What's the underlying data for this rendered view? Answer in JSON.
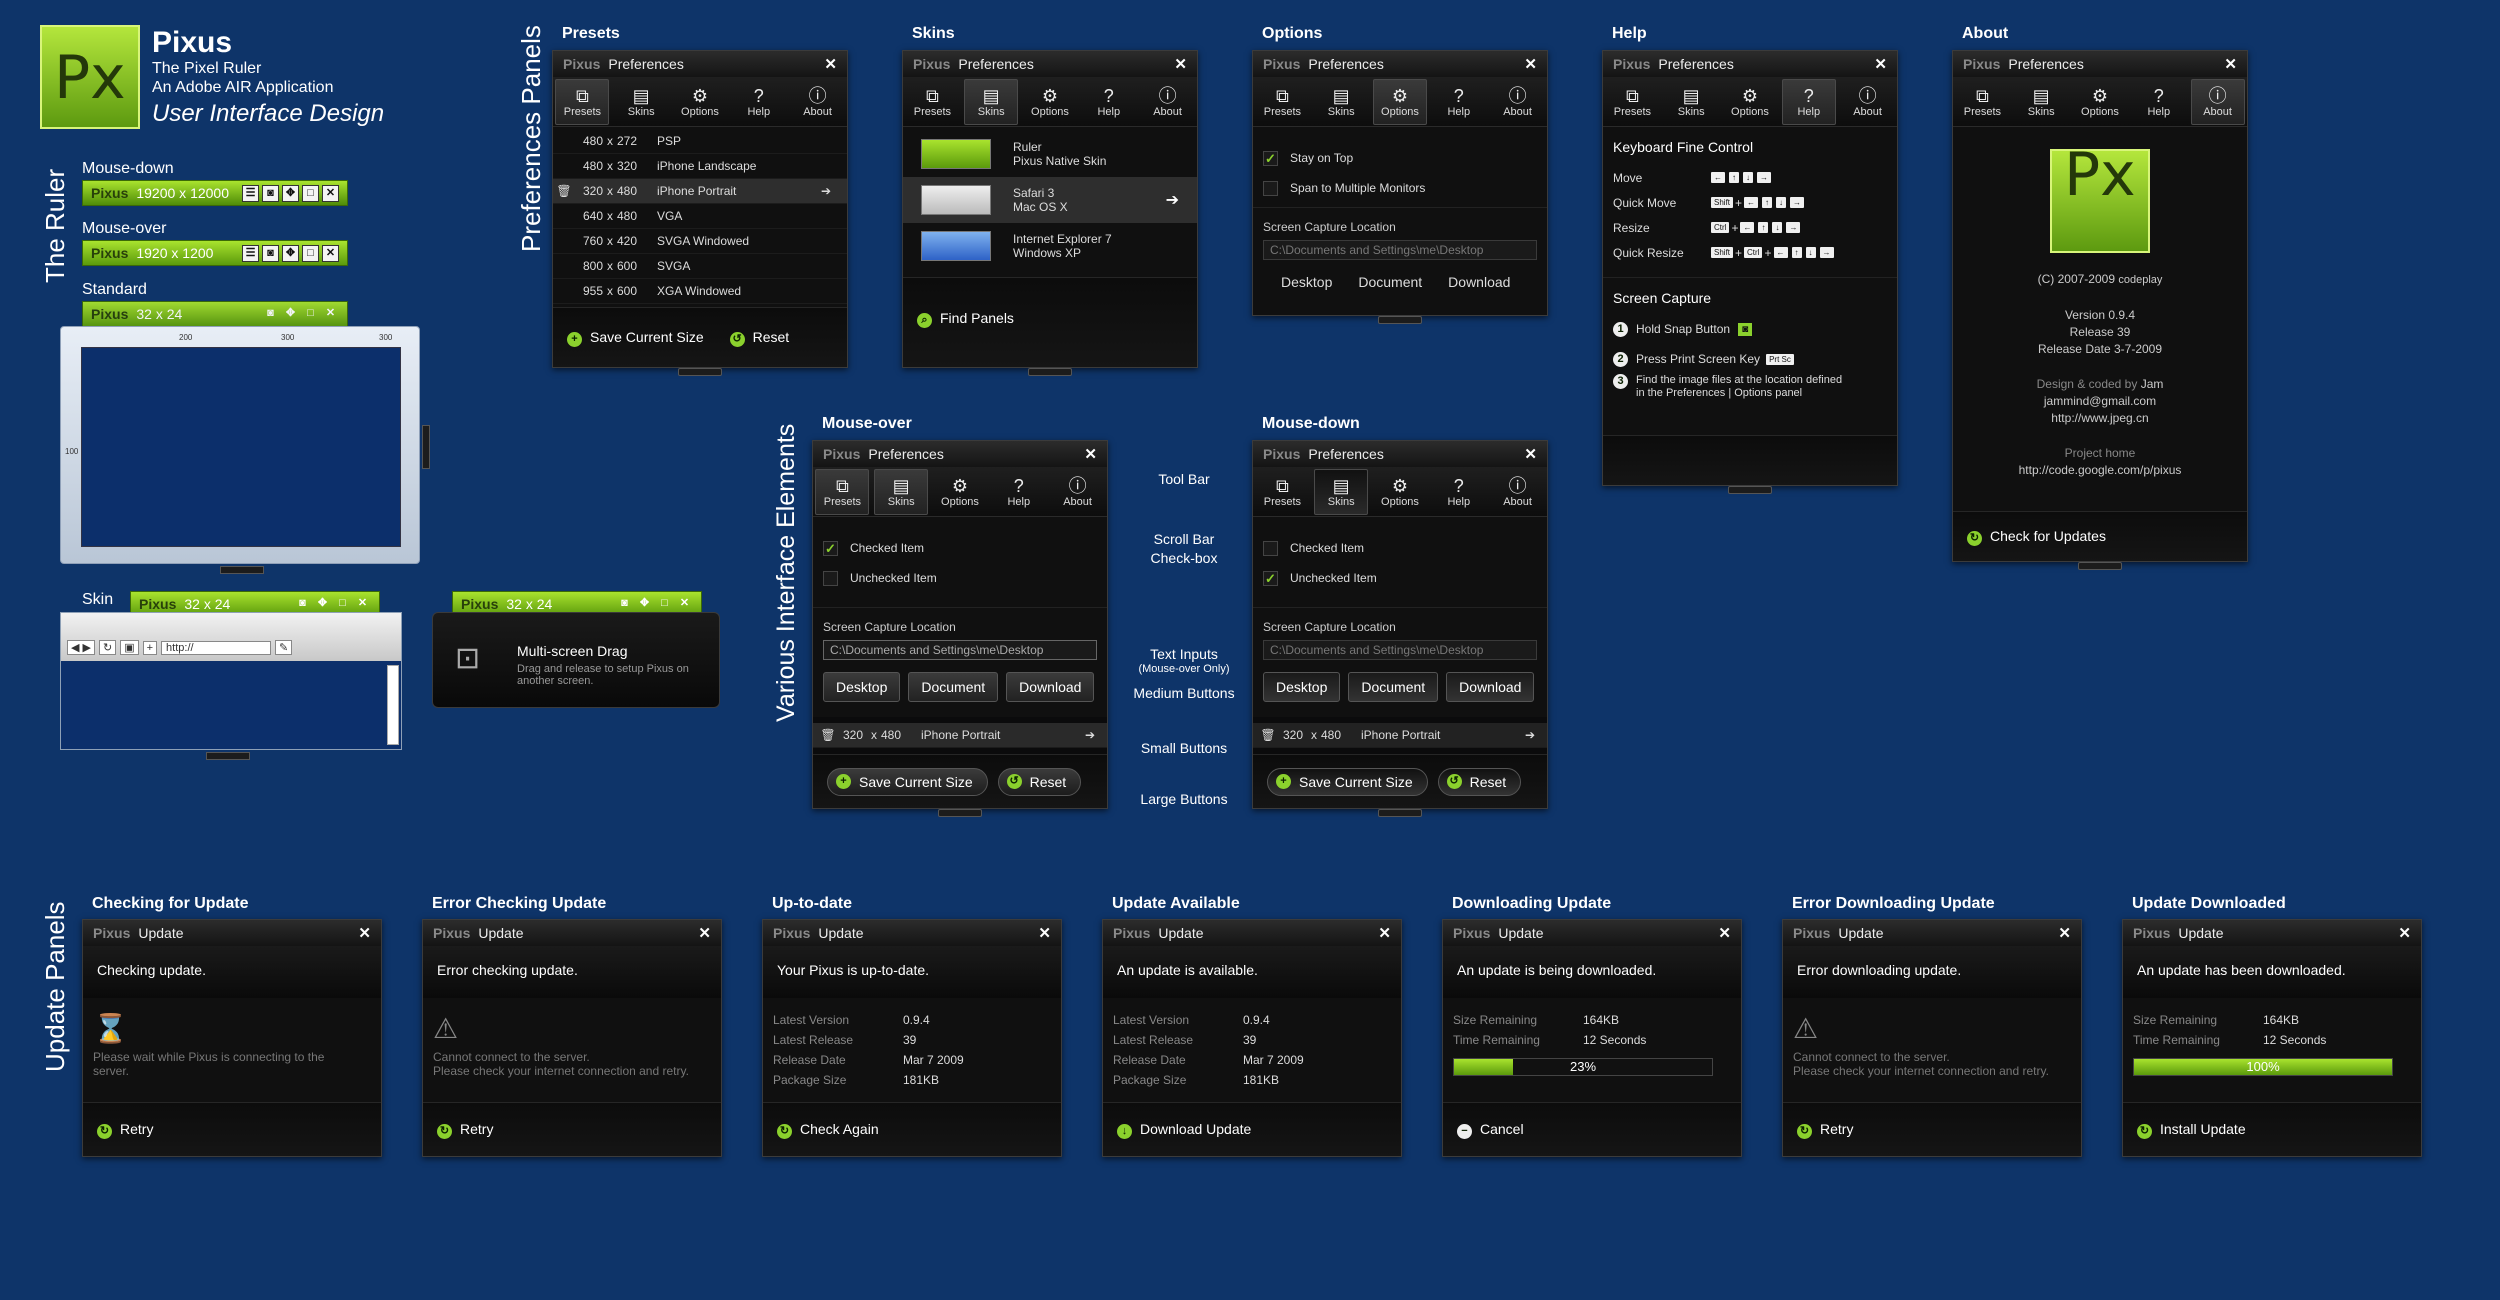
{
  "brand": {
    "name": "Pixus",
    "sub1": "The Pixel Ruler",
    "sub2": "An Adobe AIR Application",
    "sub3": "User Interface Design",
    "logo_text": "Px"
  },
  "sections": {
    "ruler": "The Ruler",
    "prefs": "Preferences Panels",
    "various": "Various Interface Elements",
    "update": "Update Panels"
  },
  "ruler": {
    "mousedown_label": "Mouse-down",
    "mousedown_size": "19200 x 12000",
    "mouseover_label": "Mouse-over",
    "mouseover_size": "1920 x 1200",
    "standard_label": "Standard",
    "standard_size": "32 x 24",
    "skin_label": "Skin",
    "skin_size": "32 x 24",
    "drag_size": "32 x 24",
    "px": "Pixus",
    "ticks": [
      "200",
      "300",
      "300"
    ],
    "side_tick": "100",
    "browser_url": "http://"
  },
  "drag": {
    "title": "Multi-screen Drag",
    "desc": "Drag and release to setup Pixus on another screen."
  },
  "panel_common": {
    "px": "Pixus",
    "title": "Preferences",
    "close": "✕"
  },
  "tabs": [
    "Presets",
    "Skins",
    "Options",
    "Help",
    "About"
  ],
  "presets": {
    "heading": "Presets",
    "rows": [
      {
        "w": "480",
        "h": "272",
        "name": "PSP"
      },
      {
        "w": "480",
        "h": "320",
        "name": "iPhone Landscape"
      },
      {
        "w": "320",
        "h": "480",
        "name": "iPhone Portrait"
      },
      {
        "w": "640",
        "h": "480",
        "name": "VGA"
      },
      {
        "w": "760",
        "h": "420",
        "name": "SVGA Windowed"
      },
      {
        "w": "800",
        "h": "600",
        "name": "SVGA"
      },
      {
        "w": "955",
        "h": "600",
        "name": "XGA Windowed"
      }
    ],
    "sep": "x",
    "save": "Save Current Size",
    "reset": "Reset"
  },
  "skins": {
    "heading": "Skins",
    "items": [
      {
        "l1": "Ruler",
        "l2": "Pixus Native Skin"
      },
      {
        "l1": "Safari 3",
        "l2": "Mac OS X"
      },
      {
        "l1": "Internet Explorer 7",
        "l2": "Windows XP"
      }
    ],
    "find": "Find Panels"
  },
  "options": {
    "heading": "Options",
    "stay": "Stay on Top",
    "span": "Span to Multiple Monitors",
    "loc_label": "Screen Capture Location",
    "loc_value": "C:\\Documents and Settings\\me\\Desktop",
    "b1": "Desktop",
    "b2": "Document",
    "b3": "Download"
  },
  "help": {
    "heading": "Help",
    "kfc": "Keyboard Fine Control",
    "move": "Move",
    "qmove": "Quick Move",
    "resize": "Resize",
    "qresize": "Quick Resize",
    "shift": "Shift",
    "ctrl": "Ctrl",
    "plus": "+",
    "sc": "Screen Capture",
    "s1": "Hold Snap Button",
    "s2": "Press Print Screen Key",
    "prtsc": "Prt Sc",
    "s3a": "Find the image files at the location defined",
    "s3b": "in the Preferences | Options panel",
    "n1": "1",
    "n2": "2",
    "n3": "3"
  },
  "about": {
    "heading": "About",
    "copy": "(C) 2007-2009",
    "copy2": "codeplay",
    "version": "Version 0.9.4",
    "release": "Release 39",
    "date": "Release Date 3-7-2009",
    "design": "Design & coded by",
    "designer": "Jam",
    "email": "jammind@gmail.com",
    "site": "http://www.jpeg.cn",
    "ph": "Project home",
    "url": "http://code.google.com/p/pixus",
    "check": "Check for Updates"
  },
  "mo": {
    "heading": "Mouse-over"
  },
  "md": {
    "heading": "Mouse-down"
  },
  "ve": {
    "checked": "Checked Item",
    "unchecked": "Unchecked Item",
    "preset_w": "320",
    "preset_h": "480",
    "preset_name": "iPhone Portrait"
  },
  "ve_labels": {
    "toolbar": "Tool Bar",
    "scroll": "Scroll Bar",
    "checkbox": "Check-box",
    "text": "Text Inputs",
    "textsub": "(Mouse-over Only)",
    "medium": "Medium Buttons",
    "small": "Small Buttons",
    "large": "Large Buttons"
  },
  "update_common": {
    "px": "Pixus",
    "title": "Update",
    "close": "✕"
  },
  "updates": [
    {
      "heading": "Checking for Update",
      "msg": "Checking update.",
      "body1": "Please wait while Pixus is connecting to the",
      "body2": "server.",
      "action": "Retry"
    },
    {
      "heading": "Error Checking Update",
      "msg": "Error checking update.",
      "body1": "Cannot connect to the server.",
      "body2": "Please check your internet connection and retry.",
      "action": "Retry"
    },
    {
      "heading": "Up-to-date",
      "msg": "Your Pixus is up-to-date.",
      "action": "Check Again",
      "info": [
        {
          "k": "Latest Version",
          "v": "0.9.4"
        },
        {
          "k": "Latest Release",
          "v": "39"
        },
        {
          "k": "Release Date",
          "v": "Mar 7 2009"
        },
        {
          "k": "Package Size",
          "v": "181KB"
        }
      ]
    },
    {
      "heading": "Update Available",
      "msg": "An update is available.",
      "action": "Download Update",
      "info": [
        {
          "k": "Latest Version",
          "v": "0.9.4"
        },
        {
          "k": "Latest Release",
          "v": "39"
        },
        {
          "k": "Release Date",
          "v": "Mar 7 2009"
        },
        {
          "k": "Package Size",
          "v": "181KB"
        }
      ]
    },
    {
      "heading": "Downloading Update",
      "msg": "An update is being downloaded.",
      "action": "Cancel",
      "info": [
        {
          "k": "Size Remaining",
          "v": "164KB"
        },
        {
          "k": "Time Remaining",
          "v": "12 Seconds"
        }
      ],
      "progress_label": "23%",
      "progress": 0.23
    },
    {
      "heading": "Error Downloading Update",
      "msg": "Error downloading update.",
      "body1": "Cannot connect to the server.",
      "body2": "Please check your internet connection and retry.",
      "action": "Retry"
    },
    {
      "heading": "Update Downloaded",
      "msg": "An update has been downloaded.",
      "action": "Install Update",
      "info": [
        {
          "k": "Size Remaining",
          "v": "164KB"
        },
        {
          "k": "Time Remaining",
          "v": "12 Seconds"
        }
      ],
      "progress_label": "100%",
      "progress": 1.0
    }
  ],
  "colors": {
    "bg": "#0e3469",
    "accent": "#8bd12d",
    "panel": "#0b0b0c"
  }
}
